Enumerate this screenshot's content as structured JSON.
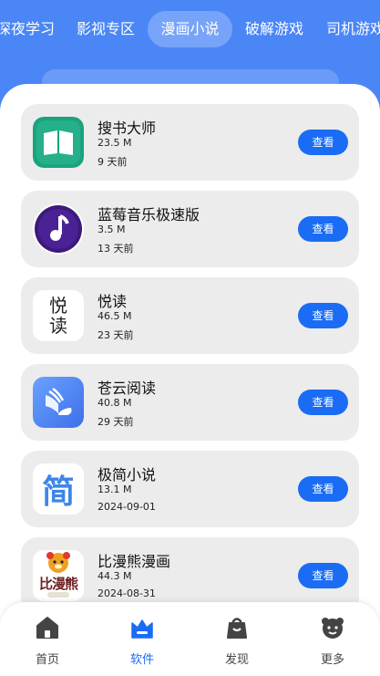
{
  "tabs": [
    {
      "label": "深夜学习"
    },
    {
      "label": "影视专区"
    },
    {
      "label": "漫画小说",
      "active": true
    },
    {
      "label": "破解游戏"
    },
    {
      "label": "司机游戏"
    }
  ],
  "apps": [
    {
      "name": "搜书大师",
      "size": "23.5 M",
      "date": "9 天前",
      "button": "查看",
      "icon": "green-book-icon"
    },
    {
      "name": "蓝莓音乐极速版",
      "size": "3.5 M",
      "date": "13 天前",
      "button": "查看",
      "icon": "purple-music-note-icon"
    },
    {
      "name": "悦读",
      "size": "46.5 M",
      "date": "23 天前",
      "button": "查看",
      "icon": "yuedu-text-icon",
      "icon_text": "悦读"
    },
    {
      "name": "苍云阅读",
      "size": "40.8 M",
      "date": "29 天前",
      "button": "查看",
      "icon": "blue-open-book-icon"
    },
    {
      "name": "极简小说",
      "size": "13.1 M",
      "date": "2024-09-01",
      "button": "查看",
      "icon": "jian-text-icon",
      "icon_text": "简"
    },
    {
      "name": "比漫熊漫画",
      "size": "44.3 M",
      "date": "2024-08-31",
      "button": "查看",
      "icon": "bear-logo-icon",
      "icon_text": "比漫熊"
    }
  ],
  "nav": [
    {
      "label": "首页",
      "icon": "home-icon"
    },
    {
      "label": "软件",
      "icon": "apps-icon",
      "active": true
    },
    {
      "label": "发现",
      "icon": "bag-icon"
    },
    {
      "label": "更多",
      "icon": "more-icon"
    }
  ],
  "colors": {
    "header": "#4a86f6",
    "accent": "#1a6cf5",
    "card": "#ececec"
  }
}
